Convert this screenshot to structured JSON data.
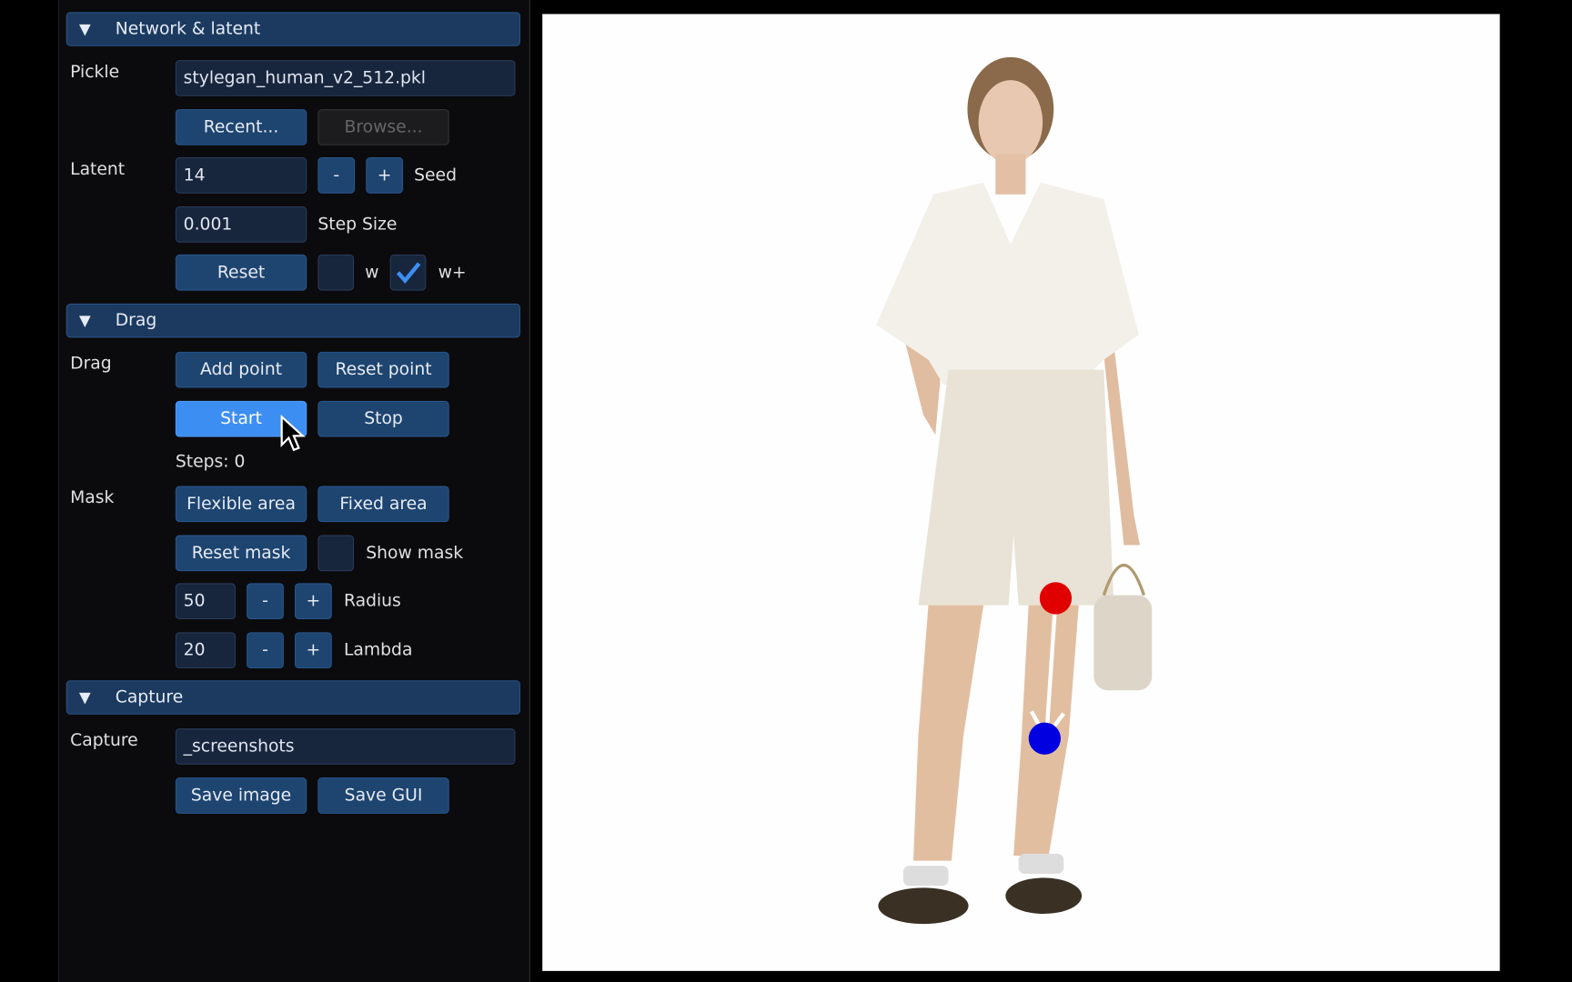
{
  "sections": {
    "network": {
      "title": "Network & latent",
      "pickle_label": "Pickle",
      "pickle_value": "stylegan_human_v2_512.pkl",
      "recent": "Recent...",
      "browse": "Browse...",
      "latent_label": "Latent",
      "seed_value": "14",
      "minus": "-",
      "plus": "+",
      "seed_label": "Seed",
      "step_value": "0.001",
      "step_label": "Step Size",
      "reset": "Reset",
      "w_label": "w",
      "wplus_label": "w+",
      "w_checked": false,
      "wplus_checked": true
    },
    "drag": {
      "title": "Drag",
      "drag_label": "Drag",
      "add_point": "Add point",
      "reset_point": "Reset point",
      "start": "Start",
      "stop": "Stop",
      "steps": "Steps: 0",
      "mask_label": "Mask",
      "flexible": "Flexible area",
      "fixed": "Fixed area",
      "reset_mask": "Reset mask",
      "show_mask": "Show mask",
      "show_mask_checked": false,
      "radius_value": "50",
      "radius_label": "Radius",
      "lambda_value": "20",
      "lambda_label": "Lambda",
      "minus": "-",
      "plus": "+"
    },
    "capture": {
      "title": "Capture",
      "capture_label": "Capture",
      "capture_value": "_screenshots",
      "save_image": "Save image",
      "save_gui": "Save GUI"
    }
  },
  "points": {
    "handle_color": "#e00000",
    "target_color": "#0000e0"
  },
  "colors": {
    "accent": "#3d8ef2",
    "header": "#1c3a60",
    "button": "#1e4470"
  }
}
